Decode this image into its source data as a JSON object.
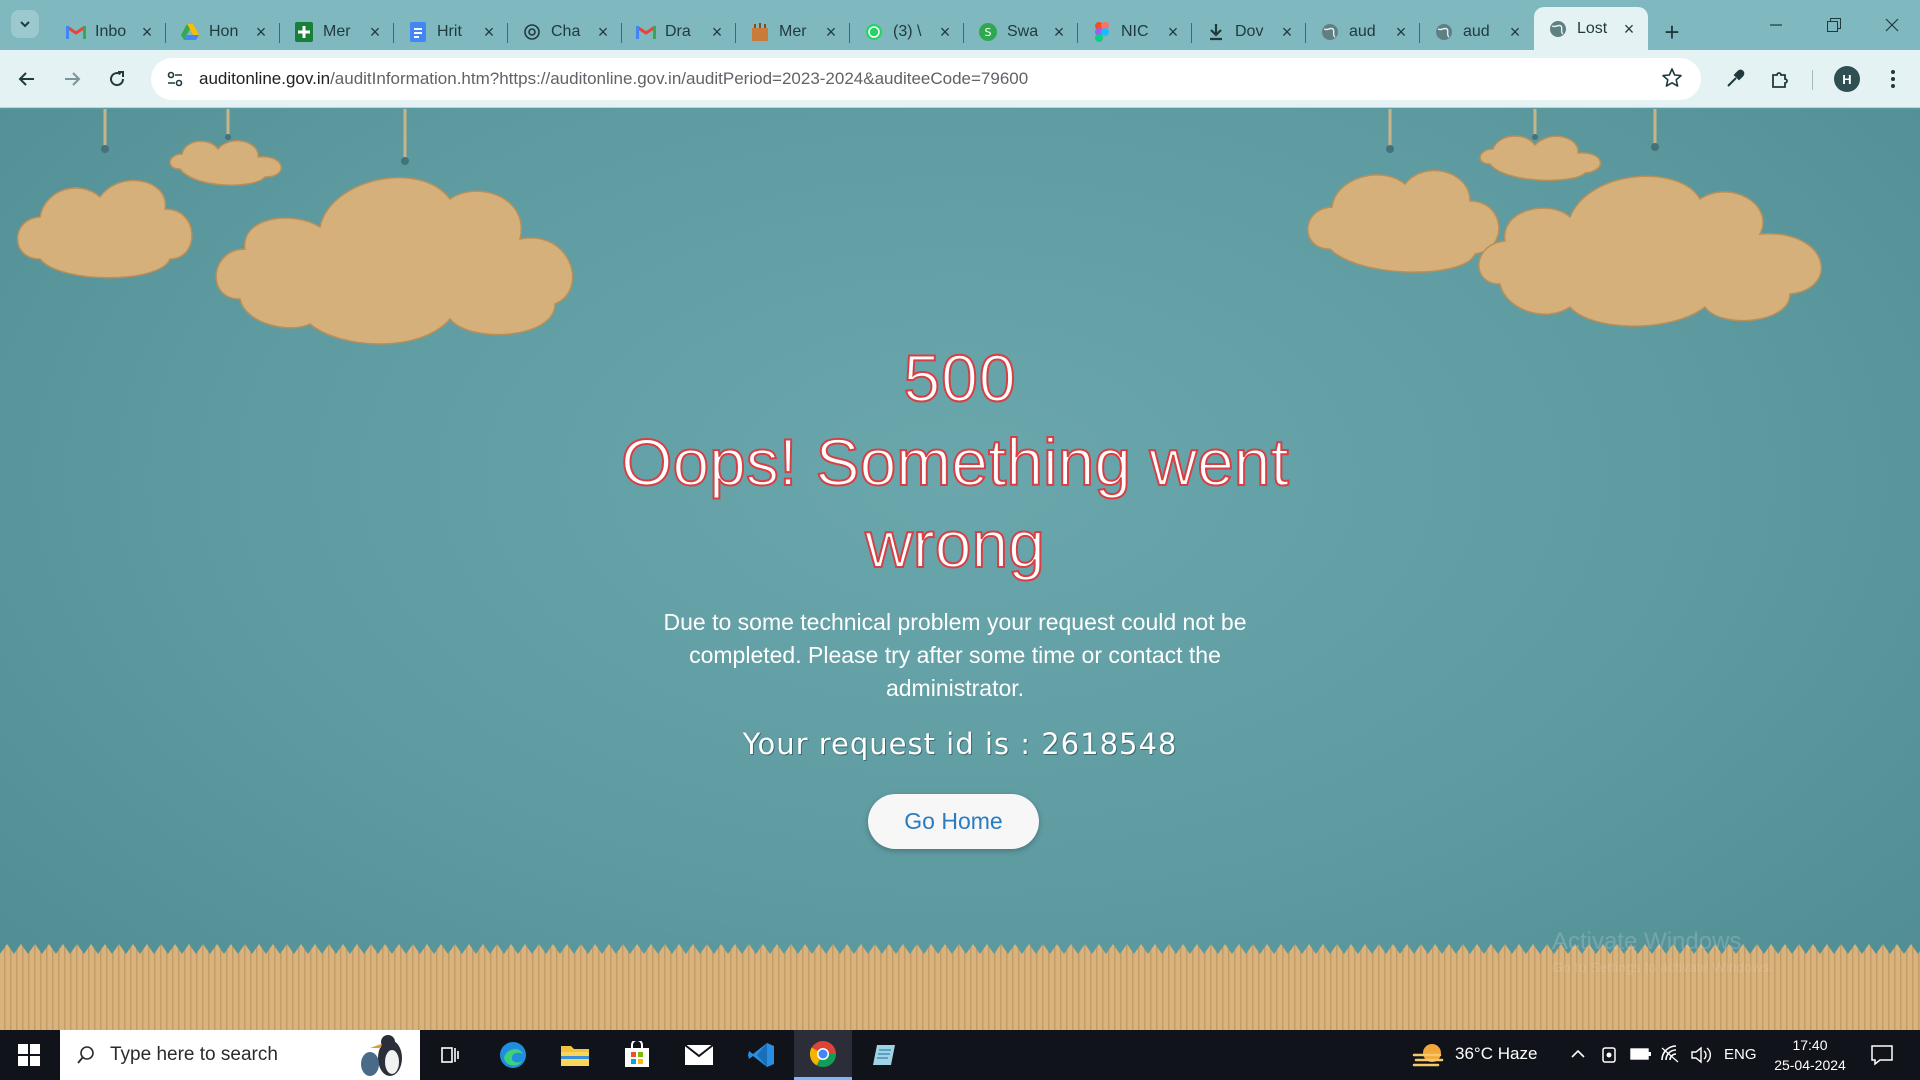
{
  "browser": {
    "tabs": [
      {
        "title": "Inbo",
        "icon": "gmail-icon"
      },
      {
        "title": "Hon",
        "icon": "google-drive-icon"
      },
      {
        "title": "Mer",
        "icon": "google-sheets-icon"
      },
      {
        "title": "Hrit",
        "icon": "google-docs-icon"
      },
      {
        "title": "Cha",
        "icon": "chatgpt-icon"
      },
      {
        "title": "Dra",
        "icon": "gmail-icon"
      },
      {
        "title": "Mer",
        "icon": "tally-icon"
      },
      {
        "title": "(3) \\",
        "icon": "whatsapp-icon"
      },
      {
        "title": "Swa",
        "icon": "swayam-icon"
      },
      {
        "title": "NIC",
        "icon": "figma-icon"
      },
      {
        "title": "Dov",
        "icon": "download-icon"
      },
      {
        "title": "aud",
        "icon": "globe-icon"
      },
      {
        "title": "aud",
        "icon": "globe-icon"
      },
      {
        "title": "Lost",
        "icon": "globe-icon",
        "active": true
      }
    ],
    "url_host": "auditonline.gov.in",
    "url_path": "/auditInformation.htm?https://auditonline.gov.in/auditPeriod=2023-2024&auditeeCode=79600",
    "profile_initial": "H"
  },
  "page": {
    "code": "500",
    "title": "Oops! Something went wrong",
    "description": "Due to some technical problem your request could not be completed. Please try after some time or contact the administrator.",
    "request_label": "Your request id is : 2618548",
    "button_label": "Go Home",
    "watermark": "Activate Windows",
    "watermark_sub": "Go to Settings to activate Windows."
  },
  "taskbar": {
    "search_placeholder": "Type here to search",
    "weather": "36°C  Haze",
    "language": "ENG",
    "time": "17:40",
    "date": "25-04-2024"
  },
  "colors": {
    "page_bg": "#5b9aa0",
    "error_stroke": "#d64045",
    "button_text": "#2a7bbf",
    "cloud": "#d9b27a"
  }
}
